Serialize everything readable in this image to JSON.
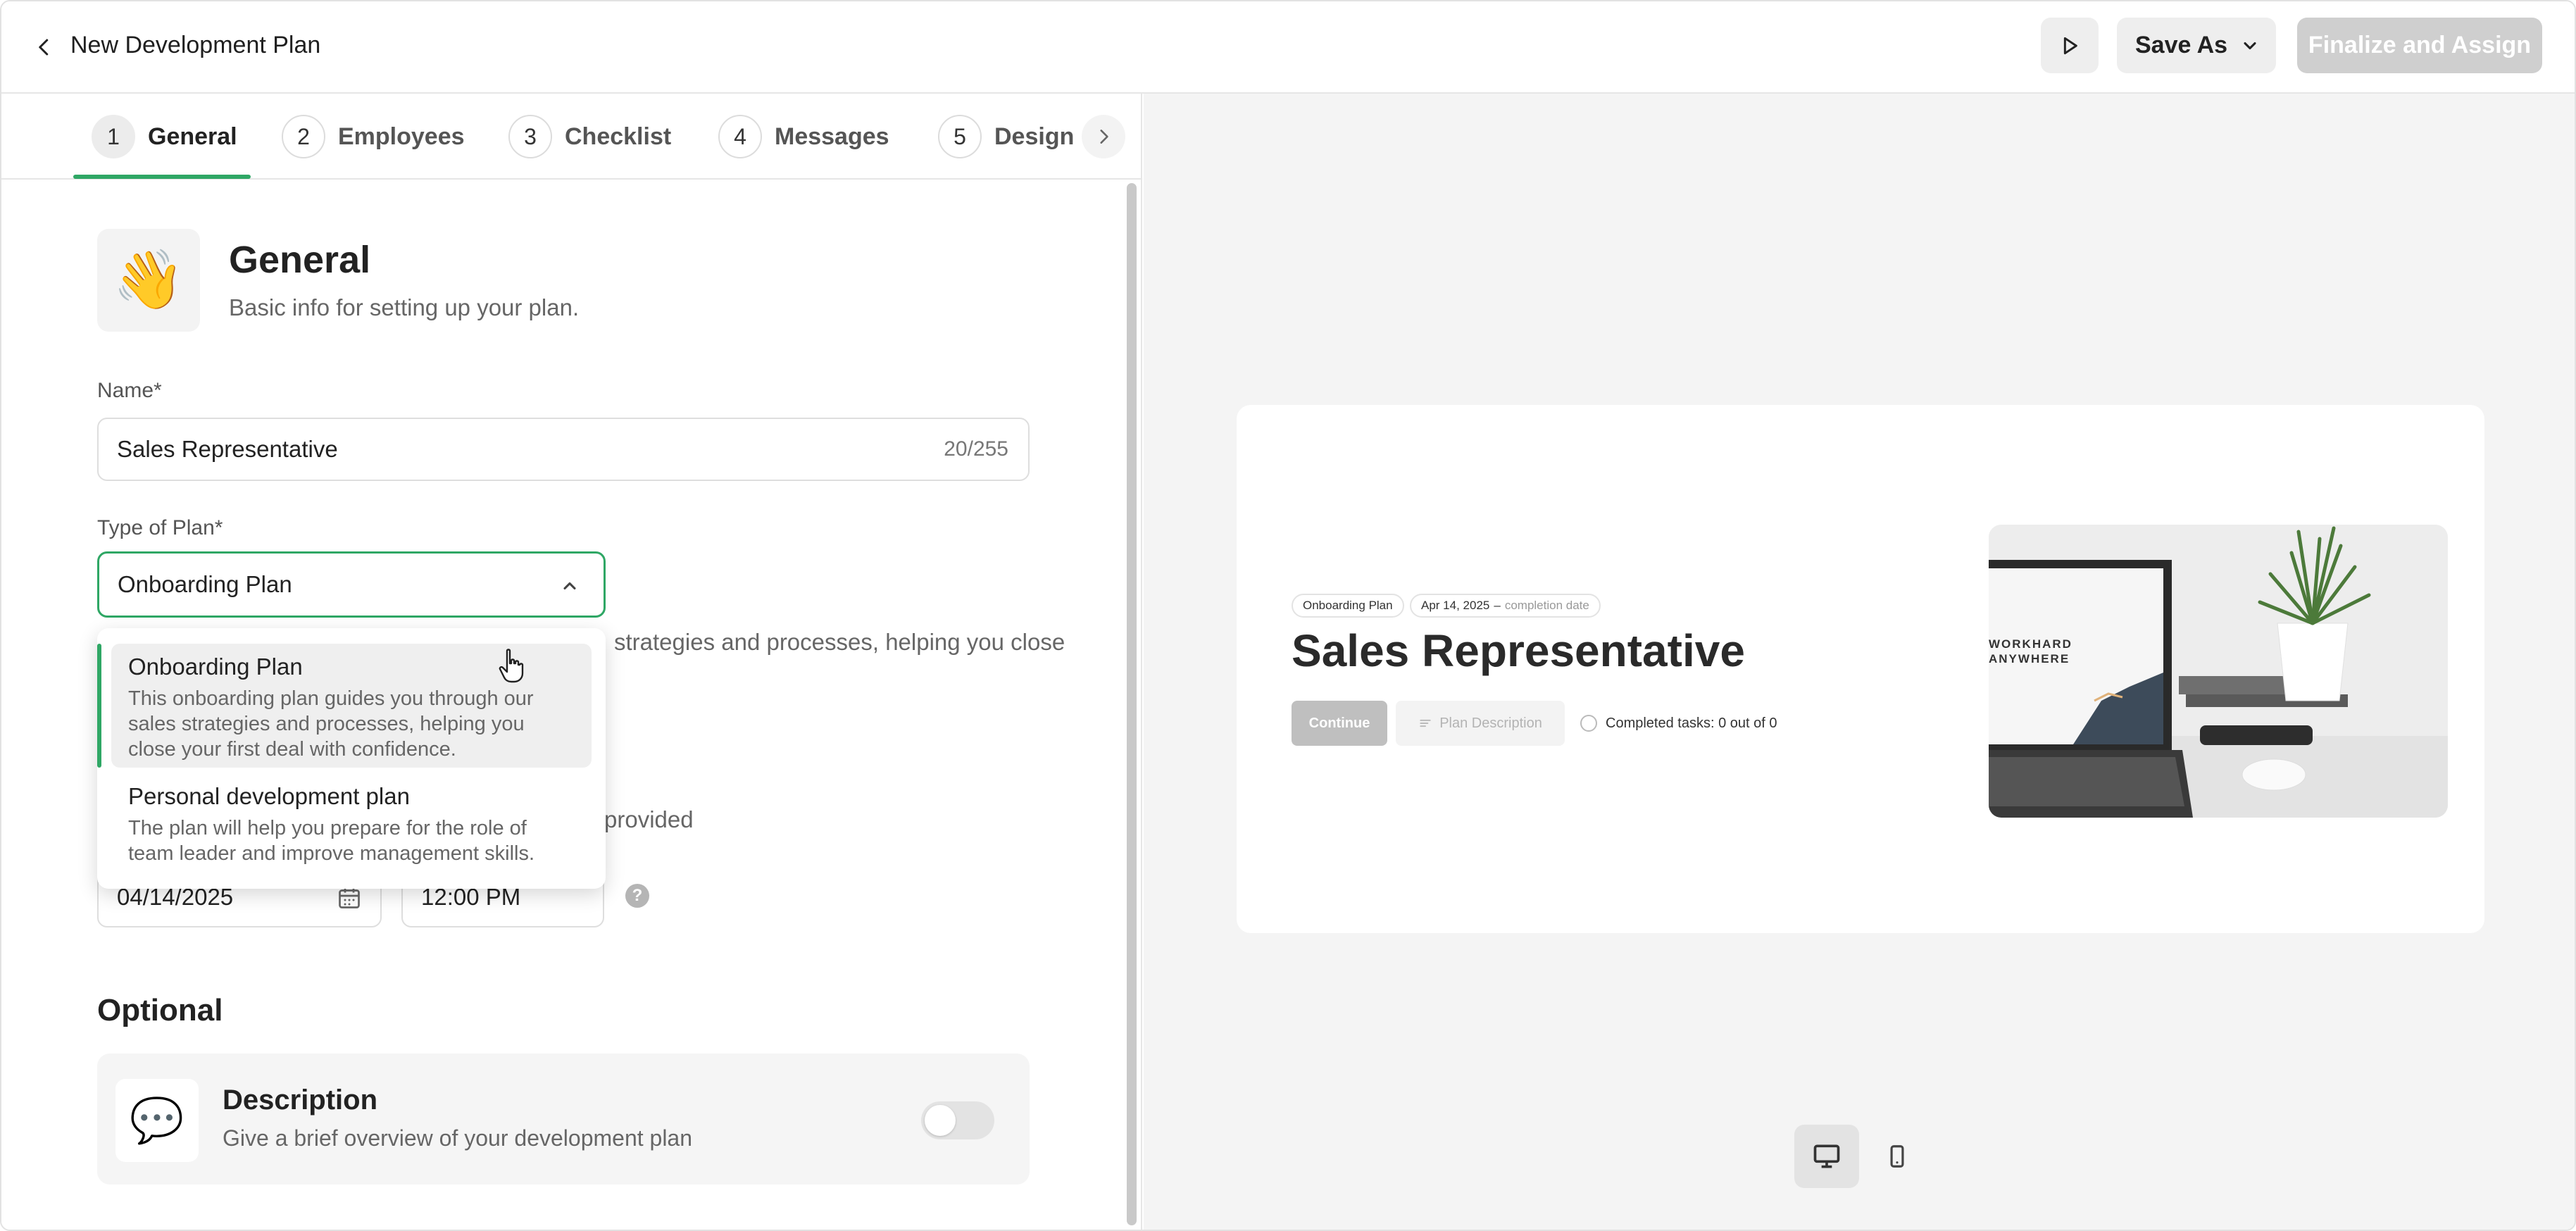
{
  "header": {
    "title": "New Development Plan",
    "save_as_label": "Save As",
    "finalize_label": "Finalize and Assign"
  },
  "tabs": [
    {
      "num": "1",
      "label": "General"
    },
    {
      "num": "2",
      "label": "Employees"
    },
    {
      "num": "3",
      "label": "Checklist"
    },
    {
      "num": "4",
      "label": "Messages"
    },
    {
      "num": "5",
      "label": "Design"
    }
  ],
  "general": {
    "title": "General",
    "subtitle": "Basic info for setting up your plan.",
    "name_label": "Name*",
    "name_value": "Sales Representative",
    "name_counter": "20/255",
    "type_label": "Type of Plan*",
    "type_value": "Onboarding Plan",
    "type_hint_fragment": "strategies and processes, helping you close",
    "date_hint_fragment": "provided",
    "date_value": "04/14/2025",
    "time_value": "12:00 PM"
  },
  "dropdown": {
    "options": [
      {
        "title": "Onboarding Plan",
        "description": "This onboarding plan guides you through our sales strategies and processes, helping you close your first deal with confidence."
      },
      {
        "title": "Personal development plan",
        "description": "The plan will help you prepare for the role of team leader and improve management skills."
      }
    ]
  },
  "optional": {
    "title": "Optional",
    "description_title": "Description",
    "description_sub": "Give a brief overview of your development plan"
  },
  "preview": {
    "chip_type": "Onboarding Plan",
    "chip_date": "Apr 14, 2025",
    "chip_date_suffix": "completion date",
    "title": "Sales Representative",
    "continue_label": "Continue",
    "plan_description_label": "Plan Description",
    "completed_tasks": "Completed tasks: 0 out of 0",
    "image_text_line1": "WORKHARD",
    "image_text_line2": "ANYWHERE"
  },
  "colors": {
    "accent": "#2fa765",
    "disabled_button": "#cfcfcf"
  }
}
